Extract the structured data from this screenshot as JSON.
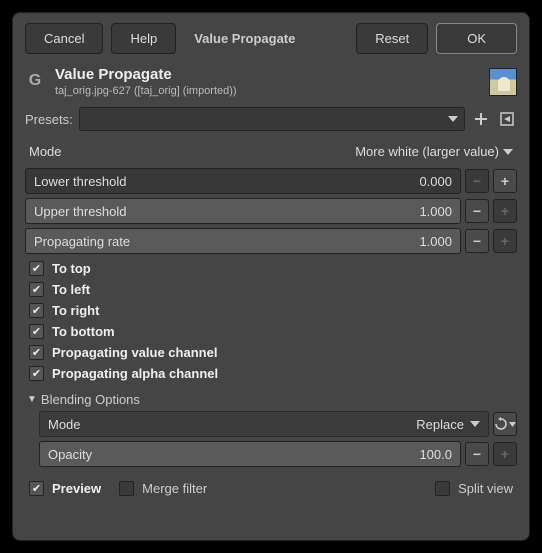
{
  "buttons": {
    "cancel": "Cancel",
    "help": "Help",
    "title_btn": "Value Propagate",
    "reset": "Reset",
    "ok": "OK"
  },
  "header": {
    "title": "Value Propagate",
    "subtitle": "taj_orig.jpg-627 ([taj_orig] (imported))"
  },
  "presets": {
    "label": "Presets:"
  },
  "mode": {
    "label": "Mode",
    "value": "More white (larger value)"
  },
  "sliders": {
    "lower": {
      "label": "Lower threshold",
      "value": "0.000"
    },
    "upper": {
      "label": "Upper threshold",
      "value": "1.000"
    },
    "rate": {
      "label": "Propagating rate",
      "value": "1.000"
    }
  },
  "checks": {
    "top": "To top",
    "left": "To left",
    "right": "To right",
    "bottom": "To bottom",
    "value_ch": "Propagating value channel",
    "alpha_ch": "Propagating alpha channel"
  },
  "blending": {
    "header": "Blending Options",
    "mode_label": "Mode",
    "mode_value": "Replace",
    "opacity_label": "Opacity",
    "opacity_value": "100.0"
  },
  "footer": {
    "preview": "Preview",
    "merge": "Merge filter",
    "split": "Split view"
  }
}
